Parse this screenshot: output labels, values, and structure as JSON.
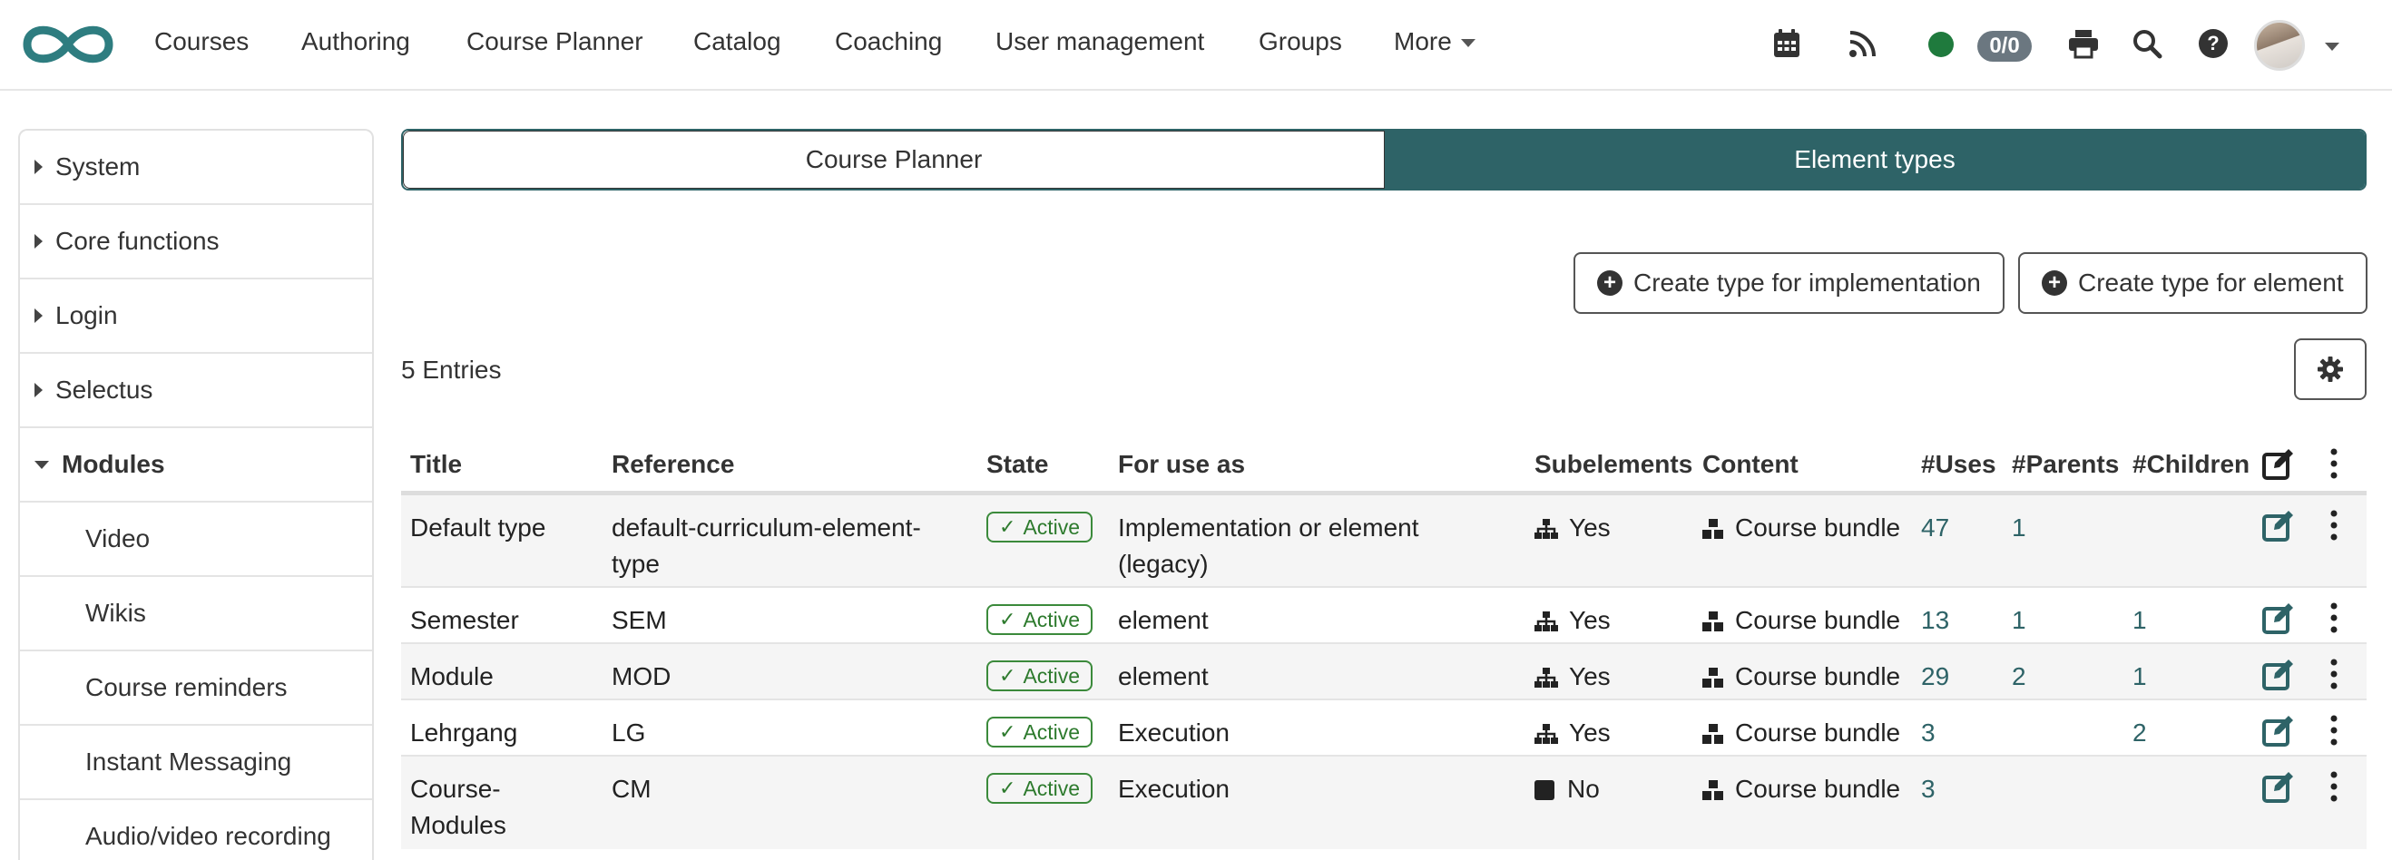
{
  "nav": {
    "items": [
      "Courses",
      "Authoring",
      "Course Planner",
      "Catalog",
      "Coaching",
      "User management",
      "Groups",
      "More"
    ],
    "im_count": "0/0"
  },
  "sidebar": {
    "items": [
      {
        "label": "System"
      },
      {
        "label": "Core functions"
      },
      {
        "label": "Login"
      },
      {
        "label": "Selectus"
      },
      {
        "label": "Modules"
      },
      {
        "label": "Video"
      },
      {
        "label": "Wikis"
      },
      {
        "label": "Course reminders"
      },
      {
        "label": "Instant Messaging"
      },
      {
        "label": "Audio/video recording"
      }
    ]
  },
  "tabs": {
    "course_planner": "Course Planner",
    "element_types": "Element types"
  },
  "actions": {
    "create_impl": "Create type for implementation",
    "create_element": "Create type for element"
  },
  "table": {
    "entries": "5 Entries",
    "headers": {
      "title": "Title",
      "reference": "Reference",
      "state": "State",
      "for_use_as": "For use as",
      "subelements": "Subelements",
      "content": "Content",
      "uses": "#Uses",
      "parents": "#Parents",
      "children": "#Children"
    },
    "rows": [
      {
        "title": "Default type",
        "reference": "default-curriculum-element-type",
        "state": "Active",
        "for_use_as": "Implementation or element (legacy)",
        "subelements": "Yes",
        "content": "Course bundle",
        "uses": "47",
        "parents": "1",
        "children": ""
      },
      {
        "title": "Semester",
        "reference": "SEM",
        "state": "Active",
        "for_use_as": "element",
        "subelements": "Yes",
        "content": "Course bundle",
        "uses": "13",
        "parents": "1",
        "children": "1"
      },
      {
        "title": "Module",
        "reference": "MOD",
        "state": "Active",
        "for_use_as": "element",
        "subelements": "Yes",
        "content": "Course bundle",
        "uses": "29",
        "parents": "2",
        "children": "1"
      },
      {
        "title": "Lehrgang",
        "reference": "LG",
        "state": "Active",
        "for_use_as": "Execution",
        "subelements": "Yes",
        "content": "Course bundle",
        "uses": "3",
        "parents": "",
        "children": "2"
      },
      {
        "title": "Course-Modules",
        "reference": "CM",
        "state": "Active",
        "for_use_as": "Execution",
        "subelements": "No",
        "content": "Course bundle",
        "uses": "3",
        "parents": "",
        "children": ""
      }
    ]
  },
  "colors": {
    "accent": "#2e6367",
    "active_badge": "#2d7a2d",
    "online_status": "#1f7a3d"
  }
}
